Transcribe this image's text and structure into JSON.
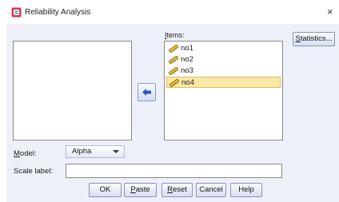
{
  "window": {
    "title": "Reliability Analysis",
    "close_symbol": "×",
    "app_icon": "reliability-analysis-icon"
  },
  "source_list": {
    "items": []
  },
  "items_list": {
    "label_first": "I",
    "label_rest": "tems:",
    "items": [
      {
        "label": "no1",
        "icon": "scale-ruler-icon",
        "selected": false
      },
      {
        "label": "no2",
        "icon": "scale-ruler-icon",
        "selected": false
      },
      {
        "label": "no3",
        "icon": "scale-ruler-icon",
        "selected": false
      },
      {
        "label": "no4",
        "icon": "scale-ruler-icon",
        "selected": true
      }
    ]
  },
  "move_button": {
    "icon": "move-left-arrow-icon"
  },
  "buttons": {
    "statistics_first": "S",
    "statistics_rest": "tatistics...",
    "ok": "OK",
    "paste_first": "P",
    "paste_rest": "aste",
    "reset_first": "R",
    "reset_rest": "eset",
    "cancel": "Cancel",
    "help": "Help"
  },
  "model": {
    "label_first": "M",
    "label_rest": "odel:",
    "selected": "Alpha"
  },
  "scale_label": {
    "label": "Scale label:",
    "value": ""
  },
  "colors": {
    "panel_background": "#eef0f9",
    "selection_background": "#fbe8a6",
    "button_border": "#8694b8"
  }
}
